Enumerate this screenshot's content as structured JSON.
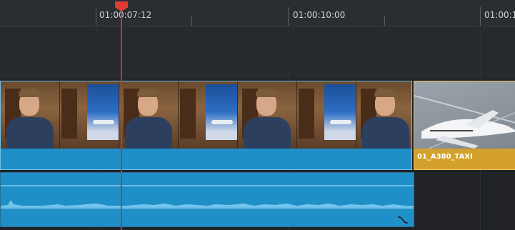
{
  "ruler": {
    "timecodes": [
      "01:00:07:12",
      "01:00:10:00",
      "01:00:1"
    ]
  },
  "clips": {
    "interview": {
      "name": ""
    },
    "broll": {
      "name": "01_A380_TAXI"
    }
  },
  "colors": {
    "video_clip": "#1f8fc8",
    "selected_clip": "#d4a12c",
    "playhead": "#e03b33"
  }
}
